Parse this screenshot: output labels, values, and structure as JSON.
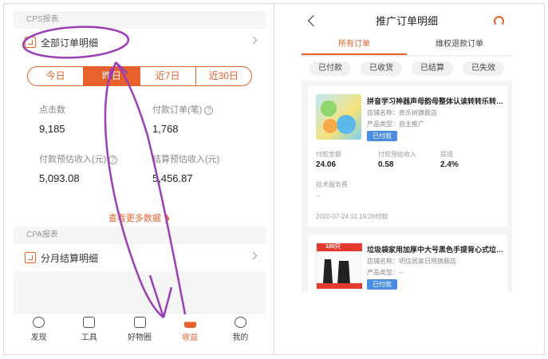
{
  "left": {
    "cps_label": "CPS报表",
    "all_orders": "全部订单明细",
    "segments": [
      "今日",
      "昨日",
      "近7日",
      "近30日"
    ],
    "active_segment_index": 1,
    "metrics": {
      "clicks_label": "点击数",
      "clicks_value": "9,185",
      "paid_orders_label": "付款订单(笔)",
      "paid_orders_value": "1,768",
      "paid_income_label": "付款预估收入(元)",
      "paid_income_value": "5,093.08",
      "settled_income_label": "结算预估收入(元)",
      "settled_income_value": "5,456.87"
    },
    "more_data": "查看更多数据",
    "cpa_label": "CPA报表",
    "monthly": "分月结算明细",
    "tabs": [
      {
        "label": "发现",
        "icon": "smile-icon"
      },
      {
        "label": "工具",
        "icon": "toolbox-icon"
      },
      {
        "label": "好物圈",
        "icon": "bag-icon"
      },
      {
        "label": "收益",
        "icon": "chart-icon"
      },
      {
        "label": "我的",
        "icon": "person-icon"
      }
    ],
    "active_tab_index": 3,
    "help_glyph": "?"
  },
  "right": {
    "title": "推广订单明细",
    "tabs": [
      "所有订单",
      "维权退款订单"
    ],
    "active_tab_index": 0,
    "filters": [
      "已付款",
      "已收货",
      "已结算",
      "已失效"
    ],
    "orders": [
      {
        "title": "拼音学习神器声母韵母整体认读转转乐转盘...",
        "shop": "店铺名称：奇乐树旗舰店",
        "type": "产品类型：自主推广",
        "status": "已付款",
        "amount_label": "付款金额",
        "amount": "24.06",
        "income_label": "付款预估收入",
        "income": "0.58",
        "rate_label": "提成",
        "rate": "2.4%",
        "fee_label": "技术服务费",
        "fee": "--",
        "time": "2020-07-24 01:19:26付款"
      },
      {
        "title": "垃圾袋家用加厚中大号黑色手提背心式垃圾...",
        "shop": "店铺名称：明信居家日用旗舰店",
        "type": "产品类型：--",
        "status": "已付款",
        "thumb_text": "100只"
      }
    ]
  },
  "colors": {
    "accent": "#e8612c",
    "badge": "#4a8de0",
    "annotation": "#9b3fb5"
  }
}
